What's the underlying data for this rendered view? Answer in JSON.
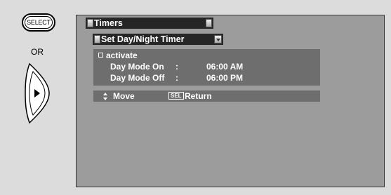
{
  "left_controls": {
    "select_button_label": "SELECT",
    "or_label": "OR",
    "arrow_icon": "right-arrow-icon"
  },
  "screen": {
    "title": "Timers",
    "submenu": "Set Day/Night Timer",
    "options": {
      "activate_label": "activate",
      "day_mode_on_label": "Day Mode On",
      "day_mode_on_sep": ":",
      "day_mode_on_value": "06:00 AM",
      "day_mode_off_label": "Day Mode Off",
      "day_mode_off_sep": ":",
      "day_mode_off_value": "06:00 PM"
    },
    "status": {
      "move_label": "Move",
      "sel_key": "SEL",
      "return_label": "Return"
    }
  },
  "colors": {
    "screen_bg": "#9c9c9c",
    "bar_bg": "#262626",
    "panel_bg": "#6e6e6e",
    "text": "#ffffff"
  }
}
